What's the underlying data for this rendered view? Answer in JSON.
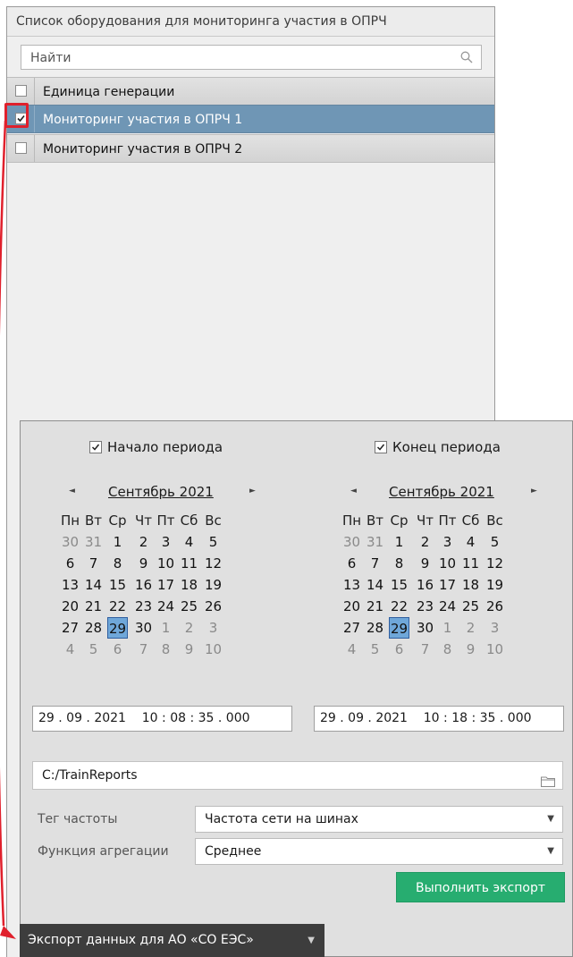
{
  "panel": {
    "title": "Список оборудования для мониторинга участия в ОПРЧ",
    "search_placeholder": "Найти",
    "items": [
      {
        "label": "Единица генерации",
        "checked": false,
        "selected": false
      },
      {
        "label": "Мониторинг участия в ОПРЧ 1",
        "checked": true,
        "selected": true
      },
      {
        "label": "Мониторинг участия в ОПРЧ 2",
        "checked": false,
        "selected": false
      }
    ]
  },
  "export": {
    "start": {
      "label": "Начало периода",
      "checked": true,
      "month": "Сентябрь 2021",
      "datetime": "29 . 09 . 2021    10 : 08 : 35 . 000"
    },
    "end": {
      "label": "Конец периода",
      "checked": true,
      "month": "Сентябрь 2021",
      "datetime": "29 . 09 . 2021    10 : 18 : 35 . 000"
    },
    "weekdays": [
      "Пн",
      "Вт",
      "Ср",
      "Чт",
      "Пт",
      "Сб",
      "Вс"
    ],
    "weeks": [
      [
        "30",
        "31",
        "1",
        "2",
        "3",
        "4",
        "5"
      ],
      [
        "6",
        "7",
        "8",
        "9",
        "10",
        "11",
        "12"
      ],
      [
        "13",
        "14",
        "15",
        "16",
        "17",
        "18",
        "19"
      ],
      [
        "20",
        "21",
        "22",
        "23",
        "24",
        "25",
        "26"
      ],
      [
        "27",
        "28",
        "29",
        "30",
        "1",
        "2",
        "3"
      ],
      [
        "4",
        "5",
        "6",
        "7",
        "8",
        "9",
        "10"
      ]
    ],
    "selected_day": "29",
    "path": "C:/TrainReports",
    "tag_label": "Тег частоты",
    "tag_value": "Частота сети на шинах",
    "agg_label": "Функция агрегации",
    "agg_value": "Среднее",
    "button": "Выполнить экспорт"
  },
  "bottom_bar": {
    "label": "Экспорт данных для АО «СО ЕЭС»"
  },
  "colors": {
    "selection": "#6f96b5",
    "accent_button": "#27ad70",
    "highlight": "#e0202c",
    "selected_day": "#6fa7d9"
  }
}
